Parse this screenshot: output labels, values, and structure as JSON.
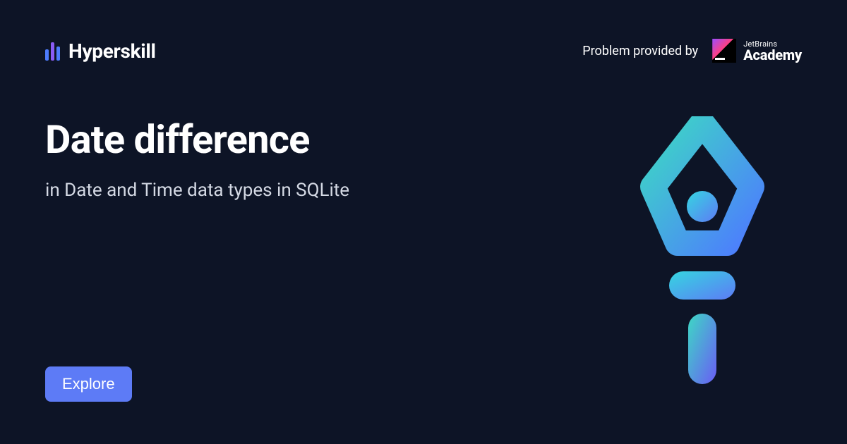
{
  "header": {
    "brand_name": "Hyperskill",
    "provided_label": "Problem provided by",
    "provider_top": "JetBrains",
    "provider_bottom": "Academy"
  },
  "main": {
    "title": "Date difference",
    "subtitle": "in Date and Time data types in SQLite"
  },
  "cta": {
    "explore_label": "Explore"
  }
}
